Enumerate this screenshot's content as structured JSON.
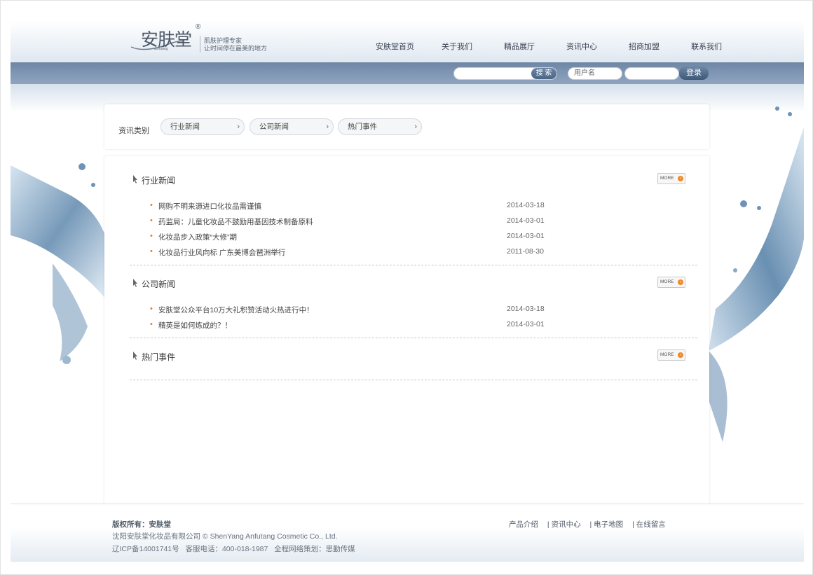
{
  "brand": {
    "logo_text": "安肤堂",
    "logo_sub": "anfutang",
    "slogan_line1": "肌肤护理专家",
    "slogan_line2": "让时间停在最美的地方"
  },
  "nav": {
    "items": [
      "安肤堂首页",
      "关于我们",
      "精品展厅",
      "资讯中心",
      "招商加盟",
      "联系我们"
    ]
  },
  "toolbar": {
    "search_label": "搜 索",
    "username_placeholder": "用户名",
    "login_label": "登录"
  },
  "categories": {
    "label": "资讯类别",
    "items": [
      "行业新闻",
      "公司新闻",
      "热门事件"
    ]
  },
  "sections": [
    {
      "title": "行业新闻",
      "more_label": "MORE",
      "items": [
        {
          "title": "网购不明来源进口化妆品需谨慎",
          "date": "2014-03-18"
        },
        {
          "title": "药监局：儿童化妆品不鼓励用基因技术制备原料",
          "date": "2014-03-01"
        },
        {
          "title": "化妆品步入政策“大修”期",
          "date": "2014-03-01"
        },
        {
          "title": "化妆品行业风向标 广东美博会琶洲举行",
          "date": "2011-08-30"
        }
      ]
    },
    {
      "title": "公司新闻",
      "more_label": "MORE",
      "items": [
        {
          "title": "安肤堂公众平台10万大礼积赞活动火热进行中！",
          "date": "2014-03-18"
        },
        {
          "title": "精英是如何炼成的？！",
          "date": "2014-03-01"
        }
      ]
    },
    {
      "title": "热门事件",
      "more_label": "MORE",
      "items": []
    }
  ],
  "footer": {
    "copyright_label": "版权所有：安肤堂",
    "company_line": "沈阳安肤堂化妆品有限公司 © ShenYang Anfutang Cosmetic Co., Ltd.",
    "info_line": "辽ICP备14001741号   客服电话：400-018-1987   全程网络策划：思勤传媒",
    "links": [
      "产品介绍",
      "资讯中心",
      "电子地图",
      "在线留言"
    ],
    "separator": "|"
  },
  "colors": {
    "nav_bar": "#7f97b4",
    "bullet": "#e27b2a",
    "more_dot": "#f08a24"
  }
}
